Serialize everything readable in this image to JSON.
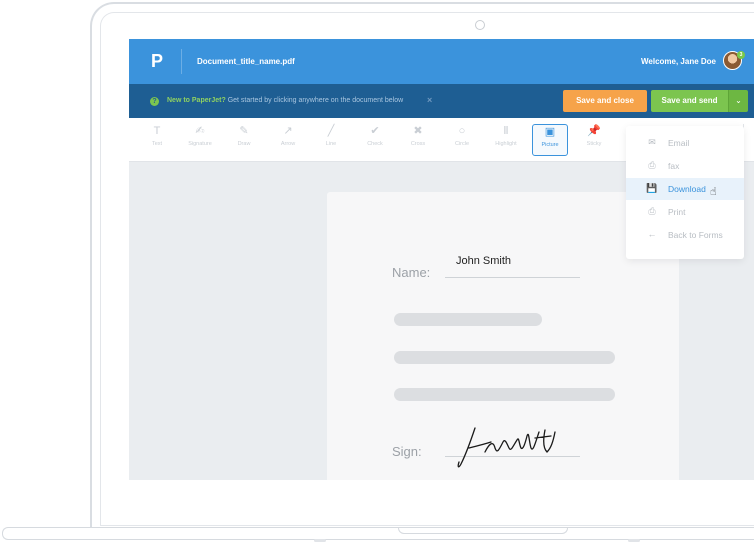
{
  "app": {
    "logo": "P",
    "document_title": "Document_title_name.pdf",
    "welcome": "Welcome, Jane Doe",
    "notification_count": "3",
    "brand_color": "#3b93dc"
  },
  "infobar": {
    "help_icon": "?",
    "highlight": "New to PaperJet?",
    "message": "Get started by clicking anywhere on the document below",
    "close_icon": "×",
    "save_close_label": "Save and close",
    "save_send_label": "Save and send",
    "send_caret": "⌄"
  },
  "toolbar": {
    "tools": [
      {
        "label": "Text",
        "icon": "T"
      },
      {
        "label": "Signature",
        "icon": "✍"
      },
      {
        "label": "Draw",
        "icon": "✎"
      },
      {
        "label": "Arrow",
        "icon": "↗"
      },
      {
        "label": "Line",
        "icon": "╱"
      },
      {
        "label": "Check",
        "icon": "✔"
      },
      {
        "label": "Cross",
        "icon": "✖"
      },
      {
        "label": "Circle",
        "icon": "○"
      },
      {
        "label": "Highlight",
        "icon": "Ⅱ"
      },
      {
        "label": "Picture",
        "icon": "▣"
      },
      {
        "label": "Sticky",
        "icon": "📌"
      }
    ],
    "active": "Picture"
  },
  "document": {
    "name_label": "Name:",
    "name_value": "John Smith",
    "sign_label": "Sign:"
  },
  "send_menu": {
    "items": [
      {
        "label": "Email",
        "icon": "✉"
      },
      {
        "label": "fax",
        "icon": "⎙"
      },
      {
        "label": "Download",
        "icon": "💾"
      },
      {
        "label": "Print",
        "icon": "⎙"
      },
      {
        "label": "Back to Forms",
        "icon": "←"
      }
    ],
    "hovered": "Download"
  }
}
